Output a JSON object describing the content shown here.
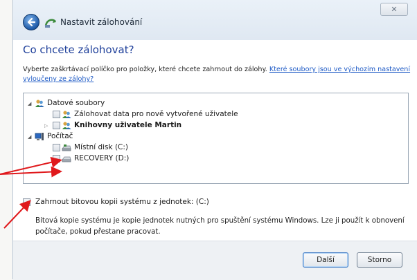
{
  "window": {
    "title": "Nastavit zálohování",
    "close_label": "✕"
  },
  "main": {
    "heading": "Co chcete zálohovat?",
    "description": "Vyberte zaškrtávací políčko pro položky, které chcete zahrnout do zálohy.",
    "link_text": "Které soubory jsou ve výchozím nastavení vyloučeny ze zálohy?"
  },
  "tree": {
    "items": [
      {
        "label": "Datové soubory",
        "expanded": true,
        "has_checkbox": false,
        "bold": false,
        "icon": "users-icon"
      },
      {
        "label": "Zálohovat data pro nově vytvořené uživatele",
        "checked": false,
        "bold": false,
        "icon": "users-icon"
      },
      {
        "label": "Knihovny uživatele Martin",
        "checked": false,
        "bold": true,
        "expanded": false,
        "icon": "user-icon"
      },
      {
        "label": "Počítač",
        "expanded": true,
        "has_checkbox": false,
        "bold": false,
        "icon": "computer-icon"
      },
      {
        "label": "Místní disk (C:)",
        "checked": false,
        "bold": false,
        "icon": "drive-icon"
      },
      {
        "label": "RECOVERY (D:)",
        "checked": false,
        "bold": false,
        "icon": "drive-icon"
      }
    ]
  },
  "system_image": {
    "label": "Zahrnout bitovou kopii systému z jednotek: (C:)",
    "checked": true,
    "note": "Bitová kopie systému je kopie jednotek nutných pro spuštění systému Windows. Lze ji použít k obnovení počítače, pokud přestane pracovat."
  },
  "buttons": {
    "next": "Další",
    "cancel": "Storno"
  },
  "colors": {
    "annotation_arrow": "#e0191c",
    "heading": "#1e3f9a",
    "link": "#1f5bc6"
  }
}
